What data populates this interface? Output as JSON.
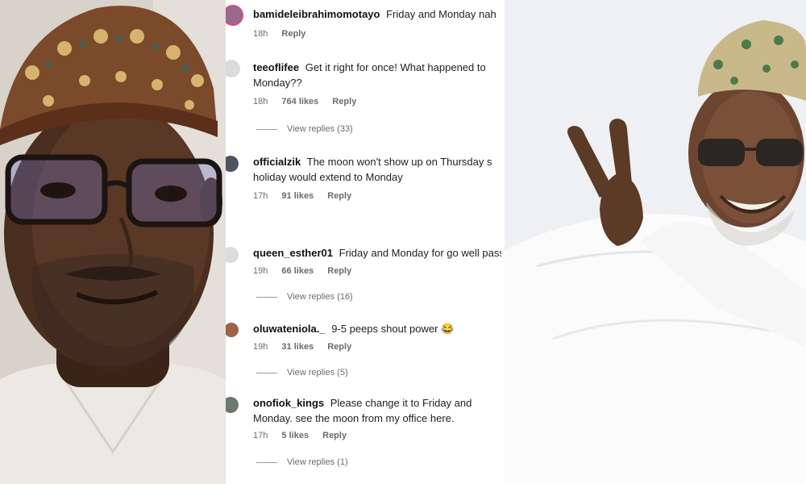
{
  "comments": [
    {
      "username": "bamideleibrahimomotayo",
      "text": "Friday and Monday nah",
      "time": "18h",
      "likes": "",
      "reply": "Reply",
      "view_replies": ""
    },
    {
      "username": "teeoflifee",
      "text": "Get it right for once! What happened to Monday??",
      "time": "18h",
      "likes": "764 likes",
      "reply": "Reply",
      "view_replies": "View replies (33)"
    },
    {
      "username": "officialzik",
      "text": "The moon won't show up on Thursday s holiday would extend to Monday",
      "time": "17h",
      "likes": "91 likes",
      "reply": "Reply",
      "view_replies": ""
    },
    {
      "username": "queen_esther01",
      "text": "Friday and Monday for go well pass n",
      "time": "19h",
      "likes": "66 likes",
      "reply": "Reply",
      "view_replies": "View replies (16)"
    },
    {
      "username": "oluwateniola._",
      "text": "9-5 peeps shout power 😂",
      "time": "19h",
      "likes": "31 likes",
      "reply": "Reply",
      "view_replies": "View replies (5)"
    },
    {
      "username": "onofiok_kings",
      "text": "Please change it to Friday and Monday. see the moon from my office here.",
      "time": "17h",
      "likes": "5 likes",
      "reply": "Reply",
      "view_replies": "View replies (1)"
    }
  ],
  "colors": {
    "background": "#ffffff",
    "text": "#222222",
    "meta": "#6b6b6b"
  }
}
